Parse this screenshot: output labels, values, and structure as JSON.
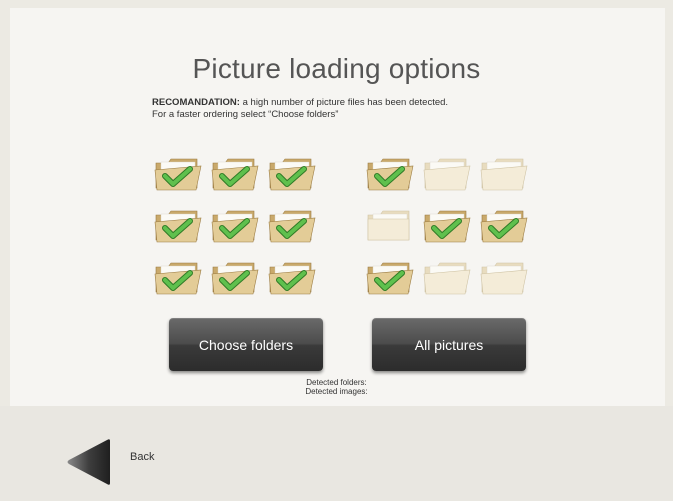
{
  "header": {
    "title": "Picture loading options"
  },
  "recommendation": {
    "label": "RECOMANDATION:",
    "text": " a high number of picture files has been detected.",
    "line2": "For a faster ordering select  “Choose folders”"
  },
  "folders_left": [
    {
      "checked": true,
      "open": true
    },
    {
      "checked": true,
      "open": true
    },
    {
      "checked": true,
      "open": true
    },
    {
      "checked": true,
      "open": true
    },
    {
      "checked": true,
      "open": true
    },
    {
      "checked": true,
      "open": true
    },
    {
      "checked": true,
      "open": true
    },
    {
      "checked": true,
      "open": true
    },
    {
      "checked": true,
      "open": true
    }
  ],
  "folders_right": [
    {
      "checked": true,
      "open": true
    },
    {
      "checked": false,
      "open": true
    },
    {
      "checked": false,
      "open": true
    },
    {
      "checked": false,
      "open": false
    },
    {
      "checked": true,
      "open": true
    },
    {
      "checked": true,
      "open": true
    },
    {
      "checked": true,
      "open": true
    },
    {
      "checked": false,
      "open": true
    },
    {
      "checked": false,
      "open": true
    }
  ],
  "buttons": {
    "choose_folders": "Choose folders",
    "all_pictures": "All pictures"
  },
  "detected": {
    "folders_label": "Detected folders:",
    "images_label": "Detected images:"
  },
  "footer": {
    "back_label": "Back"
  },
  "colors": {
    "folder_checked": "#c9a96b",
    "folder_unchecked": "#e8dcbf",
    "checkmark": "#5fc04d",
    "button_dark": "#3a3a3a"
  },
  "icons": {
    "folder": "folder-icon",
    "check": "checkmark-icon",
    "back": "back-arrow-icon"
  }
}
